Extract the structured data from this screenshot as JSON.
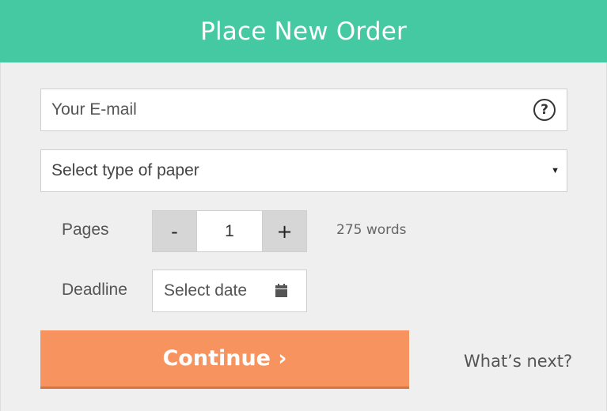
{
  "header": {
    "title": "Place New Order"
  },
  "email": {
    "placeholder": "Your E-mail",
    "value": "",
    "help_glyph": "?",
    "help_icon": "question-circle-icon"
  },
  "paper_type": {
    "selected": "Select type of paper",
    "caret": "▼"
  },
  "pages": {
    "label": "Pages",
    "decrement": "-",
    "increment": "+",
    "value": "1",
    "words": "275 words"
  },
  "deadline": {
    "label": "Deadline",
    "placeholder": "Select date",
    "icon": "calendar-icon"
  },
  "actions": {
    "continue_label": "Continue ›",
    "whats_next": "What’s next?"
  },
  "colors": {
    "header": "#45c9a3",
    "continue": "#f7935e",
    "background": "#efefef"
  }
}
